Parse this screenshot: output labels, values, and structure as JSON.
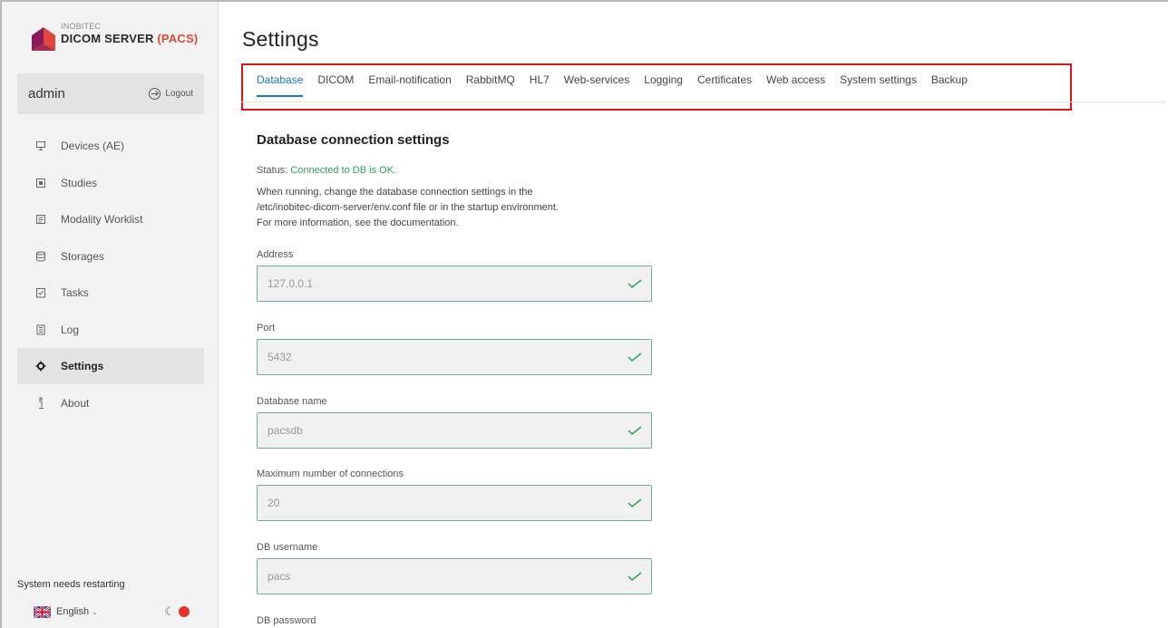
{
  "sidebar": {
    "logo": {
      "top": "INOBITEC",
      "main": "DICOM SERVER",
      "accent": "(PACS)"
    },
    "user": {
      "name": "admin",
      "logout": "Logout"
    },
    "nav": [
      {
        "label": "Devices (AE)",
        "icon": "devices-icon"
      },
      {
        "label": "Studies",
        "icon": "studies-icon"
      },
      {
        "label": "Modality Worklist",
        "icon": "worklist-icon"
      },
      {
        "label": "Storages",
        "icon": "storage-icon"
      },
      {
        "label": "Tasks",
        "icon": "tasks-icon"
      },
      {
        "label": "Log",
        "icon": "log-icon"
      },
      {
        "label": "Settings",
        "icon": "gear-icon",
        "active": true
      },
      {
        "label": "About",
        "icon": "info-icon"
      }
    ],
    "restart_note": "System needs restarting",
    "language": "English"
  },
  "main": {
    "title": "Settings",
    "tabs": [
      "Database",
      "DICOM",
      "Email-notification",
      "RabbitMQ",
      "HL7",
      "Web-services",
      "Logging",
      "Certificates",
      "Web access",
      "System settings",
      "Backup"
    ],
    "active_tab": "Database",
    "section_title": "Database connection settings",
    "status_label": "Status:",
    "status_value": "Connected to DB is OK.",
    "info_lines": [
      "When running, change the database connection settings in the",
      "/etc/inobitec-dicom-server/env.conf file or in the startup environment.",
      "For more information, see the documentation."
    ],
    "fields": [
      {
        "label": "Address",
        "value": "127.0.0.1"
      },
      {
        "label": "Port",
        "value": "5432"
      },
      {
        "label": "Database name",
        "value": "pacsdb"
      },
      {
        "label": "Maximum number of connections",
        "value": "20"
      },
      {
        "label": "DB username",
        "value": "pacs"
      },
      {
        "label": "DB password",
        "value": ""
      }
    ]
  },
  "colors": {
    "accent_blue": "#1d78b9",
    "ok_green": "#2ea44f",
    "highlight_red": "#e01414",
    "brand_red": "#e2463d",
    "brand_purple": "#8b1a5b"
  }
}
